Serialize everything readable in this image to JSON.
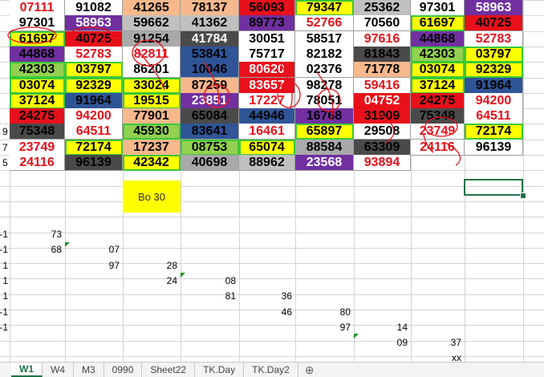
{
  "grid": {
    "rows": [
      {
        "label": "",
        "cells": [
          {
            "v": "07111",
            "bg": "#ffffff",
            "fg": "#e8101a"
          },
          {
            "v": "91082",
            "bg": "#ffffff",
            "fg": "#000000"
          },
          {
            "v": "41265",
            "bg": "#f7b88c",
            "fg": "#000000"
          },
          {
            "v": "78137",
            "bg": "#f7b88c",
            "fg": "#000000"
          },
          {
            "v": "56093",
            "bg": "#e8101a",
            "fg": "#000000"
          },
          {
            "v": "79347",
            "bg": "#ffff00",
            "fg": "#000000"
          },
          {
            "v": "25362",
            "bg": "#c0c0c0",
            "fg": "#000000"
          },
          {
            "v": "97301",
            "bg": "#ffffff",
            "fg": "#000000"
          },
          {
            "v": "58963",
            "bg": "#7030a0",
            "fg": "#ffffff"
          }
        ]
      },
      {
        "label": "",
        "cells": [
          {
            "v": "97301",
            "bg": "#ffffff",
            "fg": "#000000"
          },
          {
            "v": "58963",
            "bg": "#7030a0",
            "fg": "#ffffff"
          },
          {
            "v": "59662",
            "bg": "#c0c0c0",
            "fg": "#000000"
          },
          {
            "v": "41362",
            "bg": "#c0c0c0",
            "fg": "#000000"
          },
          {
            "v": "89773",
            "bg": "#7030a0",
            "fg": "#000000"
          },
          {
            "v": "52766",
            "bg": "#ffffff",
            "fg": "#e8101a"
          },
          {
            "v": "70560",
            "bg": "#ffffff",
            "fg": "#000000"
          },
          {
            "v": "61697",
            "bg": "#ffff00",
            "fg": "#000000"
          },
          {
            "v": "40725",
            "bg": "#e8101a",
            "fg": "#000000"
          }
        ]
      },
      {
        "label": "",
        "cells": [
          {
            "v": "61697",
            "bg": "#ffff00",
            "fg": "#000000"
          },
          {
            "v": "40725",
            "bg": "#e8101a",
            "fg": "#000000"
          },
          {
            "v": "91254",
            "bg": "#a9a9a9",
            "fg": "#000000"
          },
          {
            "v": "41784",
            "bg": "#4a4a4a",
            "fg": "#ffffff"
          },
          {
            "v": "30051",
            "bg": "#ffffff",
            "fg": "#000000"
          },
          {
            "v": "58517",
            "bg": "#ffffff",
            "fg": "#000000"
          },
          {
            "v": "97616",
            "bg": "#ffffff",
            "fg": "#e8101a"
          },
          {
            "v": "44868",
            "bg": "#7030a0",
            "fg": "#000000"
          },
          {
            "v": "52783",
            "bg": "#ffffff",
            "fg": "#e8101a"
          }
        ]
      },
      {
        "label": "",
        "cells": [
          {
            "v": "44868",
            "bg": "#7030a0",
            "fg": "#000000"
          },
          {
            "v": "52783",
            "bg": "#ffffff",
            "fg": "#e8101a"
          },
          {
            "v": "82811",
            "bg": "#ffffff",
            "fg": "#e8101a"
          },
          {
            "v": "53841",
            "bg": "#2f5597",
            "fg": "#000000"
          },
          {
            "v": "75717",
            "bg": "#ffffff",
            "fg": "#000000"
          },
          {
            "v": "82182",
            "bg": "#ffffff",
            "fg": "#000000"
          },
          {
            "v": "81843",
            "bg": "#4a4a4a",
            "fg": "#000000"
          },
          {
            "v": "42303",
            "bg": "#92d050",
            "fg": "#000000"
          },
          {
            "v": "03797",
            "bg": "#ffff00",
            "fg": "#000000"
          }
        ]
      },
      {
        "label": "",
        "cells": [
          {
            "v": "42303",
            "bg": "#92d050",
            "fg": "#000000"
          },
          {
            "v": "03797",
            "bg": "#ffff00",
            "fg": "#000000"
          },
          {
            "v": "86201",
            "bg": "#ffffff",
            "fg": "#000000"
          },
          {
            "v": "10046",
            "bg": "#2f5597",
            "fg": "#000000"
          },
          {
            "v": "80620",
            "bg": "#e8101a",
            "fg": "#ffffff"
          },
          {
            "v": "02376",
            "bg": "#ffffff",
            "fg": "#000000"
          },
          {
            "v": "71778",
            "bg": "#f7b88c",
            "fg": "#000000"
          },
          {
            "v": "03074",
            "bg": "#ffff00",
            "fg": "#000000"
          },
          {
            "v": "92329",
            "bg": "#ffff00",
            "fg": "#000000"
          }
        ]
      },
      {
        "label": "",
        "cells": [
          {
            "v": "03074",
            "bg": "#ffff00",
            "fg": "#000000"
          },
          {
            "v": "92329",
            "bg": "#ffff00",
            "fg": "#000000"
          },
          {
            "v": "33024",
            "bg": "#ffff00",
            "fg": "#000000"
          },
          {
            "v": "87259",
            "bg": "#f7b88c",
            "fg": "#000000"
          },
          {
            "v": "83657",
            "bg": "#e8101a",
            "fg": "#ffffff"
          },
          {
            "v": "98278",
            "bg": "#ffffff",
            "fg": "#000000"
          },
          {
            "v": "59416",
            "bg": "#ffffff",
            "fg": "#e8101a"
          },
          {
            "v": "37124",
            "bg": "#ffff00",
            "fg": "#000000"
          },
          {
            "v": "91964",
            "bg": "#2f5597",
            "fg": "#000000"
          }
        ]
      },
      {
        "label": "",
        "cells": [
          {
            "v": "37124",
            "bg": "#ffff00",
            "fg": "#000000"
          },
          {
            "v": "91964",
            "bg": "#2f5597",
            "fg": "#000000"
          },
          {
            "v": "19515",
            "bg": "#ffff00",
            "fg": "#000000"
          },
          {
            "v": "23851",
            "bg": "#7030a0",
            "fg": "#ffffff"
          },
          {
            "v": "17227",
            "bg": "#ffffff",
            "fg": "#e8101a"
          },
          {
            "v": "78051",
            "bg": "#ffffff",
            "fg": "#000000"
          },
          {
            "v": "04752",
            "bg": "#e8101a",
            "fg": "#ffffff"
          },
          {
            "v": "24275",
            "bg": "#e8101a",
            "fg": "#000000"
          },
          {
            "v": "94200",
            "bg": "#ffffff",
            "fg": "#e8101a"
          }
        ]
      },
      {
        "label": "",
        "cells": [
          {
            "v": "24275",
            "bg": "#e8101a",
            "fg": "#000000"
          },
          {
            "v": "94200",
            "bg": "#ffffff",
            "fg": "#e8101a"
          },
          {
            "v": "77901",
            "bg": "#f7b88c",
            "fg": "#000000"
          },
          {
            "v": "65084",
            "bg": "#4a4a4a",
            "fg": "#000000"
          },
          {
            "v": "44946",
            "bg": "#2f5597",
            "fg": "#000000"
          },
          {
            "v": "16768",
            "bg": "#7030a0",
            "fg": "#000000"
          },
          {
            "v": "31909",
            "bg": "#e8101a",
            "fg": "#000000"
          },
          {
            "v": "75348",
            "bg": "#4a4a4a",
            "fg": "#000000"
          },
          {
            "v": "64511",
            "bg": "#ffffff",
            "fg": "#e8101a"
          }
        ]
      },
      {
        "label": "9",
        "cells": [
          {
            "v": "75348",
            "bg": "#4a4a4a",
            "fg": "#000000"
          },
          {
            "v": "64511",
            "bg": "#ffffff",
            "fg": "#e8101a"
          },
          {
            "v": "45930",
            "bg": "#92d050",
            "fg": "#000000"
          },
          {
            "v": "83641",
            "bg": "#2f5597",
            "fg": "#000000"
          },
          {
            "v": "16461",
            "bg": "#ffffff",
            "fg": "#e8101a"
          },
          {
            "v": "65897",
            "bg": "#ffff00",
            "fg": "#000000"
          },
          {
            "v": "29508",
            "bg": "#ffffff",
            "fg": "#000000"
          },
          {
            "v": "23749",
            "bg": "#ffffff",
            "fg": "#e8101a"
          },
          {
            "v": "72174",
            "bg": "#ffff00",
            "fg": "#000000"
          }
        ]
      },
      {
        "label": "7",
        "cells": [
          {
            "v": "23749",
            "bg": "#ffffff",
            "fg": "#e8101a"
          },
          {
            "v": "72174",
            "bg": "#ffff00",
            "fg": "#000000"
          },
          {
            "v": "17237",
            "bg": "#f7b88c",
            "fg": "#000000"
          },
          {
            "v": "08753",
            "bg": "#92d050",
            "fg": "#000000"
          },
          {
            "v": "65074",
            "bg": "#ffff00",
            "fg": "#000000"
          },
          {
            "v": "88584",
            "bg": "#a9a9a9",
            "fg": "#000000"
          },
          {
            "v": "63309",
            "bg": "#4a4a4a",
            "fg": "#000000"
          },
          {
            "v": "24116",
            "bg": "#ffffff",
            "fg": "#e8101a"
          },
          {
            "v": "96139",
            "bg": "#ffffff",
            "fg": "#000000"
          }
        ]
      },
      {
        "label": "5",
        "cells": [
          {
            "v": "24116",
            "bg": "#ffffff",
            "fg": "#e8101a"
          },
          {
            "v": "96139",
            "bg": "#4a4a4a",
            "fg": "#000000"
          },
          {
            "v": "42342",
            "bg": "#ffff00",
            "fg": "#000000"
          },
          {
            "v": "40698",
            "bg": "#a9a9a9",
            "fg": "#000000"
          },
          {
            "v": "88962",
            "bg": "#c0c0c0",
            "fg": "#000000"
          },
          {
            "v": "23568",
            "bg": "#7030a0",
            "fg": "#ffffff"
          },
          {
            "v": "93894",
            "bg": "#ffffff",
            "fg": "#e8101a"
          }
        ]
      }
    ]
  },
  "yellow_cell": {
    "text": "Bo 30"
  },
  "lower_rows": [
    {
      "label": "-1",
      "values": [
        {
          "col": 1,
          "v": "73"
        }
      ]
    },
    {
      "label": "-1",
      "values": [
        {
          "col": 1,
          "v": "68"
        },
        {
          "col": 2,
          "v": "07"
        }
      ]
    },
    {
      "label": "1",
      "values": [
        {
          "col": 2,
          "v": "97"
        },
        {
          "col": 3,
          "v": "28"
        }
      ]
    },
    {
      "label": "1",
      "values": [
        {
          "col": 3,
          "v": "24"
        },
        {
          "col": 4,
          "v": "08"
        }
      ]
    },
    {
      "label": "1",
      "values": [
        {
          "col": 4,
          "v": "81"
        },
        {
          "col": 5,
          "v": "36"
        }
      ]
    },
    {
      "label": "-1",
      "values": [
        {
          "col": 5,
          "v": "46"
        },
        {
          "col": 6,
          "v": "80"
        }
      ]
    },
    {
      "label": "-1",
      "values": [
        {
          "col": 6,
          "v": "97"
        },
        {
          "col": 7,
          "v": "14"
        }
      ]
    },
    {
      "label": "",
      "values": [
        {
          "col": 7,
          "v": "09"
        },
        {
          "col": 8,
          "v": "37"
        }
      ]
    },
    {
      "label": "",
      "values": [
        {
          "col": 8,
          "v": "xx"
        }
      ]
    }
  ],
  "tabs": [
    {
      "label": "W1",
      "active": true
    },
    {
      "label": "W4",
      "active": false
    },
    {
      "label": "M3",
      "active": false
    },
    {
      "label": "0990",
      "active": false
    },
    {
      "label": "Sheet22",
      "active": false
    },
    {
      "label": "TK.Day",
      "active": false
    },
    {
      "label": "TK.Day2",
      "active": false
    }
  ],
  "add_sheet_icon": "plus-circle-icon",
  "colors": {
    "excel_green": "#217346",
    "annotation_red": "#e8101a"
  }
}
